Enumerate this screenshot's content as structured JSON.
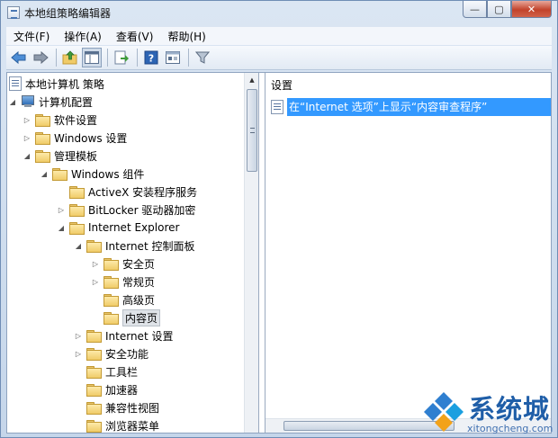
{
  "window": {
    "title": "本地组策略编辑器"
  },
  "menu": [
    {
      "label": "文件(F)"
    },
    {
      "label": "操作(A)"
    },
    {
      "label": "查看(V)"
    },
    {
      "label": "帮助(H)"
    }
  ],
  "toolbar": {
    "icons": [
      "back-arrow-icon",
      "forward-arrow-icon",
      "up-folder-icon",
      "show-hide-tree-icon",
      "export-list-icon",
      "help-icon",
      "properties-icon",
      "filter-icon"
    ]
  },
  "tree": {
    "items": [
      {
        "label": "本地计算机 策略"
      },
      {
        "label": "计算机配置"
      },
      {
        "label": "软件设置"
      },
      {
        "label": "Windows 设置"
      },
      {
        "label": "管理模板"
      },
      {
        "label": "Windows 组件"
      },
      {
        "label": "ActiveX 安装程序服务"
      },
      {
        "label": "BitLocker 驱动器加密"
      },
      {
        "label": "Internet Explorer"
      },
      {
        "label": "Internet 控制面板"
      },
      {
        "label": "安全页"
      },
      {
        "label": "常规页"
      },
      {
        "label": "高级页"
      },
      {
        "label": "内容页"
      },
      {
        "label": "Internet 设置"
      },
      {
        "label": "安全功能"
      },
      {
        "label": "工具栏"
      },
      {
        "label": "加速器"
      },
      {
        "label": "兼容性视图"
      },
      {
        "label": "浏览器菜单"
      }
    ]
  },
  "details": {
    "column_header": "设置",
    "rows": [
      {
        "label": "在“Internet 选项”上显示“内容审查程序”",
        "selected": true
      }
    ]
  },
  "watermark": {
    "text": "系统城",
    "url": "xitongcheng.com"
  },
  "colors": {
    "selection": "#3399ff",
    "folder": "#f0cb68",
    "watermark": "#1f5ea8"
  }
}
